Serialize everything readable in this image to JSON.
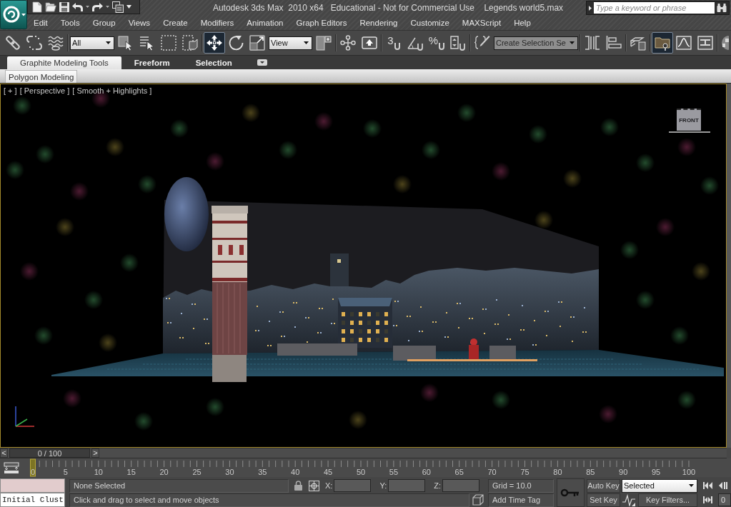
{
  "title_bar": {
    "title": "Autodesk 3ds Max  2010 x64   Educational - Not for Commercial Use    Legends world5.max",
    "search": {
      "placeholder": "Type a keyword or phrase"
    }
  },
  "menu": [
    "Edit",
    "Tools",
    "Group",
    "Views",
    "Create",
    "Modifiers",
    "Animation",
    "Graph Editors",
    "Rendering",
    "Customize",
    "MAXScript",
    "Help"
  ],
  "main_toolbar": [
    [
      {
        "kind": "tool",
        "selected": false
      },
      {
        "kind": "tool",
        "selected": false
      },
      {
        "kind": "tool",
        "selected": false
      }
    ],
    [
      {
        "kind": "dropdown",
        "value": "All"
      },
      {
        "kind": "tool",
        "selected": false
      },
      {
        "kind": "tool",
        "selected": false
      },
      {
        "kind": "tool",
        "selected": false
      },
      {
        "kind": "tool",
        "selected": false
      }
    ],
    [
      {
        "kind": "tool",
        "selected": true
      },
      {
        "kind": "tool",
        "selected": false
      },
      {
        "kind": "tool",
        "selected": false
      },
      {
        "kind": "dropdown",
        "value": "View"
      },
      {
        "kind": "tool",
        "selected": false
      }
    ],
    [
      {
        "kind": "tool",
        "selected": false
      },
      {
        "kind": "tool",
        "selected": false
      }
    ],
    [
      {
        "kind": "snap",
        "glyph": "3",
        "selected": false
      },
      {
        "kind": "tool",
        "selected": false
      },
      {
        "kind": "snap",
        "glyph": "%",
        "selected": false
      },
      {
        "kind": "tool",
        "selected": false
      }
    ],
    [
      {
        "kind": "tool",
        "selected": false
      },
      {
        "kind": "dropdown",
        "value": "Create Selection Se"
      }
    ],
    [
      {
        "kind": "tool",
        "selected": false
      },
      {
        "kind": "tool",
        "selected": false
      }
    ],
    [
      {
        "kind": "tool",
        "selected": false
      }
    ],
    [
      {
        "kind": "tool",
        "selected": true
      },
      {
        "kind": "tool",
        "selected": false
      },
      {
        "kind": "tool",
        "selected": false
      }
    ],
    [
      {
        "kind": "tool",
        "selected": false
      }
    ]
  ],
  "ribbon": {
    "tabs": [
      {
        "label": "Graphite Modeling Tools",
        "selected": true
      },
      {
        "label": "Freeform",
        "selected": false
      },
      {
        "label": "Selection",
        "selected": false
      }
    ],
    "panels": [
      "Polygon Modeling"
    ]
  },
  "viewport": {
    "labels": [
      "[ + ]",
      "[ Perspective ]",
      "[ Smooth + Highlights ]"
    ],
    "viewcube": "FRONT"
  },
  "time_slider": {
    "previous": "<",
    "position": "0 / 100",
    "next": ">",
    "level": 0
  },
  "track_bar": {
    "ticks": [
      "0",
      "5",
      "10",
      "15",
      "20",
      "25",
      "30",
      "35",
      "40",
      "45",
      "50",
      "55",
      "60",
      "65",
      "70",
      "75",
      "80",
      "85",
      "90",
      "95",
      "100"
    ],
    "level": 0
  },
  "status_bar": {
    "script_output": "Initial Clust",
    "selection": "None Selected",
    "prompt": "Click and drag to select and move objects",
    "coordinates": [
      "X:",
      "Y:",
      "Z:"
    ],
    "grid": "Grid = 10.0",
    "time_tag": "Add Time Tag",
    "auto_key": "Auto Key",
    "set_key": "Set Key",
    "key_set": "Selected",
    "key_filters": "Key Filters...",
    "frame": "0"
  }
}
